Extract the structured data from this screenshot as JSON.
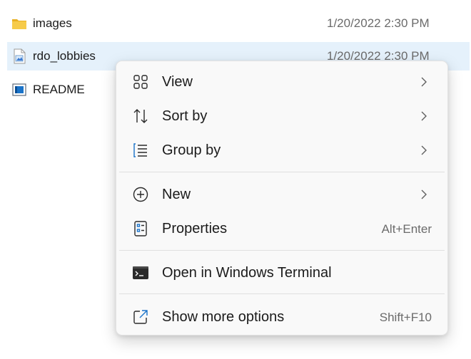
{
  "files": [
    {
      "name": "images",
      "date": "1/20/2022 2:30 PM",
      "icon": "folder-icon",
      "selected": false
    },
    {
      "name": "rdo_lobbies",
      "date": "1/20/2022 2:30 PM",
      "icon": "image-file-icon",
      "selected": true
    },
    {
      "name": "README",
      "date": "",
      "icon": "document-file-icon",
      "selected": false
    }
  ],
  "menu": {
    "view_label": "View",
    "sort_by_label": "Sort by",
    "group_by_label": "Group by",
    "new_label": "New",
    "properties_label": "Properties",
    "properties_shortcut": "Alt+Enter",
    "terminal_label": "Open in Windows Terminal",
    "more_options_label": "Show more options",
    "more_options_shortcut": "Shift+F10"
  },
  "colors": {
    "selection": "#e5f1fb",
    "menu_bg": "#f9f9f9",
    "folder": "#f3c63f",
    "accent": "#0067c0"
  }
}
